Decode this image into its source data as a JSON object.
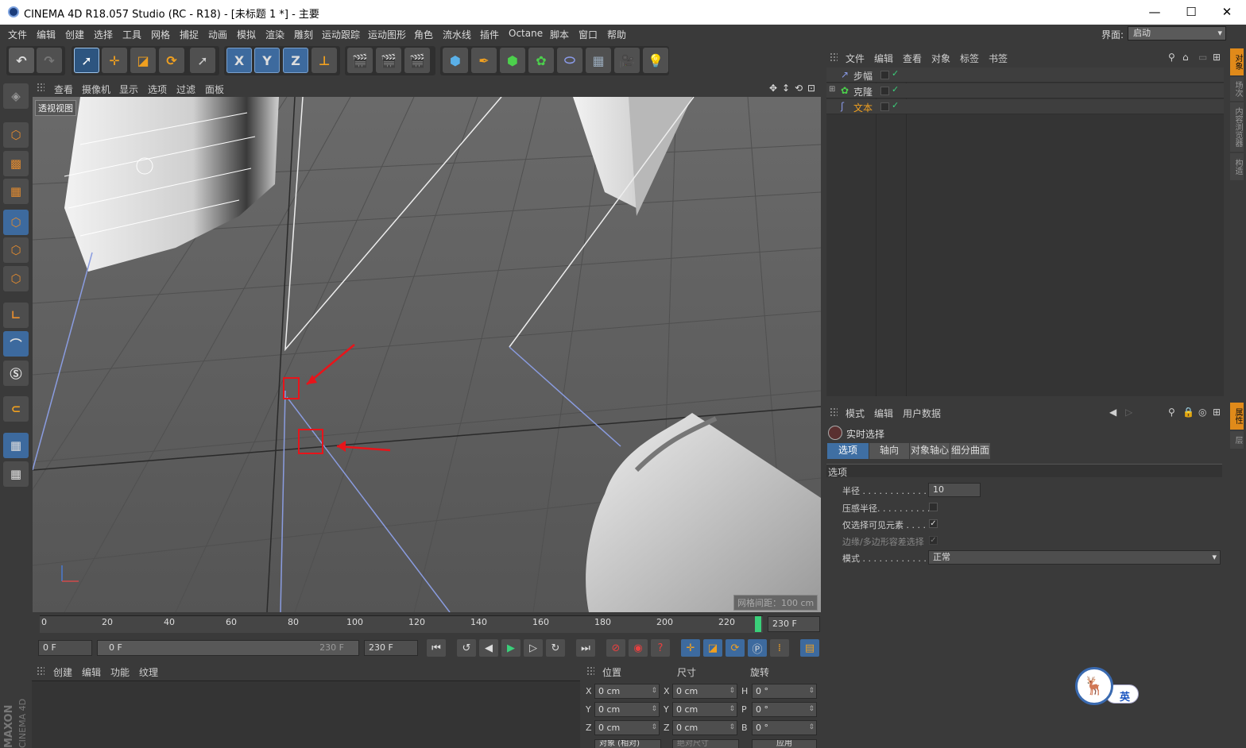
{
  "window": {
    "title": "CINEMA 4D R18.057 Studio (RC - R18) - [未标题 1 *] - 主要",
    "minimize": "—",
    "maximize": "☐",
    "close": "✕"
  },
  "menu": [
    "文件",
    "编辑",
    "创建",
    "选择",
    "工具",
    "网格",
    "捕捉",
    "动画",
    "模拟",
    "渲染",
    "雕刻",
    "运动跟踪",
    "运动图形",
    "角色",
    "流水线",
    "插件",
    "Octane",
    "脚本",
    "窗口",
    "帮助"
  ],
  "layout": {
    "label": "界面:",
    "value": "启动"
  },
  "toolbar": {
    "axis_x": "X",
    "axis_y": "Y",
    "axis_z": "Z"
  },
  "viewport_menu": [
    "查看",
    "摄像机",
    "显示",
    "选项",
    "过滤",
    "面板"
  ],
  "viewport": {
    "label": "透视视图",
    "grid_info": "网格间距：100 cm"
  },
  "timeline": {
    "ticks": [
      "0",
      "20",
      "40",
      "60",
      "80",
      "100",
      "120",
      "140",
      "160",
      "180",
      "200",
      "220"
    ],
    "end_field": "230 F"
  },
  "playback": {
    "current": "0 F",
    "range_start": "0 F",
    "range_end": "230 F",
    "max": "230 F"
  },
  "material_menu": [
    "创建",
    "编辑",
    "功能",
    "纹理"
  ],
  "coords": {
    "headers": [
      "位置",
      "尺寸",
      "旋转"
    ],
    "rows": [
      {
        "a": "X",
        "pos": "0 cm",
        "b": "X",
        "size": "0 cm",
        "c": "H",
        "rot": "0 °"
      },
      {
        "a": "Y",
        "pos": "0 cm",
        "b": "Y",
        "size": "0 cm",
        "c": "P",
        "rot": "0 °"
      },
      {
        "a": "Z",
        "pos": "0 cm",
        "b": "Z",
        "size": "0 cm",
        "c": "B",
        "rot": "0 °"
      }
    ],
    "mode": "对象 (相对)",
    "mode2": "绝对尺寸",
    "apply": "应用"
  },
  "object_manager": {
    "menu": [
      "文件",
      "编辑",
      "查看",
      "对象",
      "标签",
      "书签"
    ],
    "objects": [
      {
        "name": "步幅",
        "color": "#cfcfcf"
      },
      {
        "name": "克隆",
        "color": "#cfcfcf"
      },
      {
        "name": "文本",
        "color": "#f0a020"
      }
    ]
  },
  "attributes": {
    "menu": [
      "模式",
      "编辑",
      "用户数据"
    ],
    "tool": "实时选择",
    "tabs": [
      "选项",
      "轴向",
      "对象轴心",
      "细分曲面"
    ],
    "section": "选项",
    "radius_label": "半径 . . . . . . . . . . . . . .",
    "radius": "10",
    "pressure_label": "压感半径. . . . . . . . . . .",
    "visible_label": "仅选择可见元素 . . . .",
    "edge_label": "边缘/多边形容差选择",
    "mode_label": "模式 . . . . . . . . . . . . . .",
    "mode": "正常"
  },
  "right_tabs": [
    "对象",
    "场次",
    "内容浏览器",
    "构造",
    "属性",
    "层"
  ],
  "branding": {
    "maxon": "MAXON",
    "c4d": "CINEMA 4D",
    "ime": "英"
  },
  "colors": {
    "accent": "#e08a1a",
    "highlight": "#3f6fa3",
    "annotation": "#e8141a"
  }
}
